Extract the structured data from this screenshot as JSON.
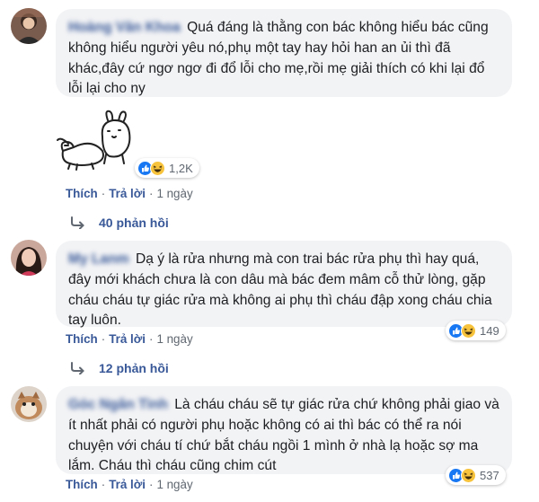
{
  "labels": {
    "like": "Thích",
    "reply": "Trả lời",
    "dot": "·"
  },
  "comments": [
    {
      "author": "Hoàng Văn Khoa",
      "text": "Quá đáng là thằng con bác không hiểu bác cũng không hiểu người yêu nó,phụ một tay hay hỏi han an ủi thì đã khác,đây cứ ngơ ngơ đi đổ lỗi cho mẹ,rồi mẹ giải thích có khi lại đổ lỗi lại cho ny",
      "reaction_count": "1,2K",
      "time": "1 ngày",
      "replies": "40 phản hồi"
    },
    {
      "author": "My Lanm",
      "text": "Dạ ý là rửa nhưng mà con trai bác rửa phụ thì hay quá, đây mới khách chưa là con dâu mà bác đem mâm cỗ thử lòng, gặp cháu cháu tự giác rửa mà không ai phụ thì cháu đập xong cháu chia tay luôn.",
      "reaction_count": "149",
      "time": "1 ngày",
      "replies": "12 phản hồi"
    },
    {
      "author": "Góc Ngân Tình",
      "text": "Là cháu cháu sẽ tự giác rửa chứ không phải giao và ít nhất phải có người phụ hoặc không có ai thì bác có thể ra nói chuyện với cháu tí chứ bắt cháu ngồi 1 mình ở nhà lạ hoặc sợ ma lắm. Cháu thì cháu cũng chim cút",
      "reaction_count": "537",
      "time": "1 ngày"
    }
  ],
  "colors": {
    "link": "#385898",
    "bubble": "#f2f3f5",
    "meta": "#606770",
    "like_blue": "#1877f2",
    "haha_yellow": "#f7c33c"
  }
}
